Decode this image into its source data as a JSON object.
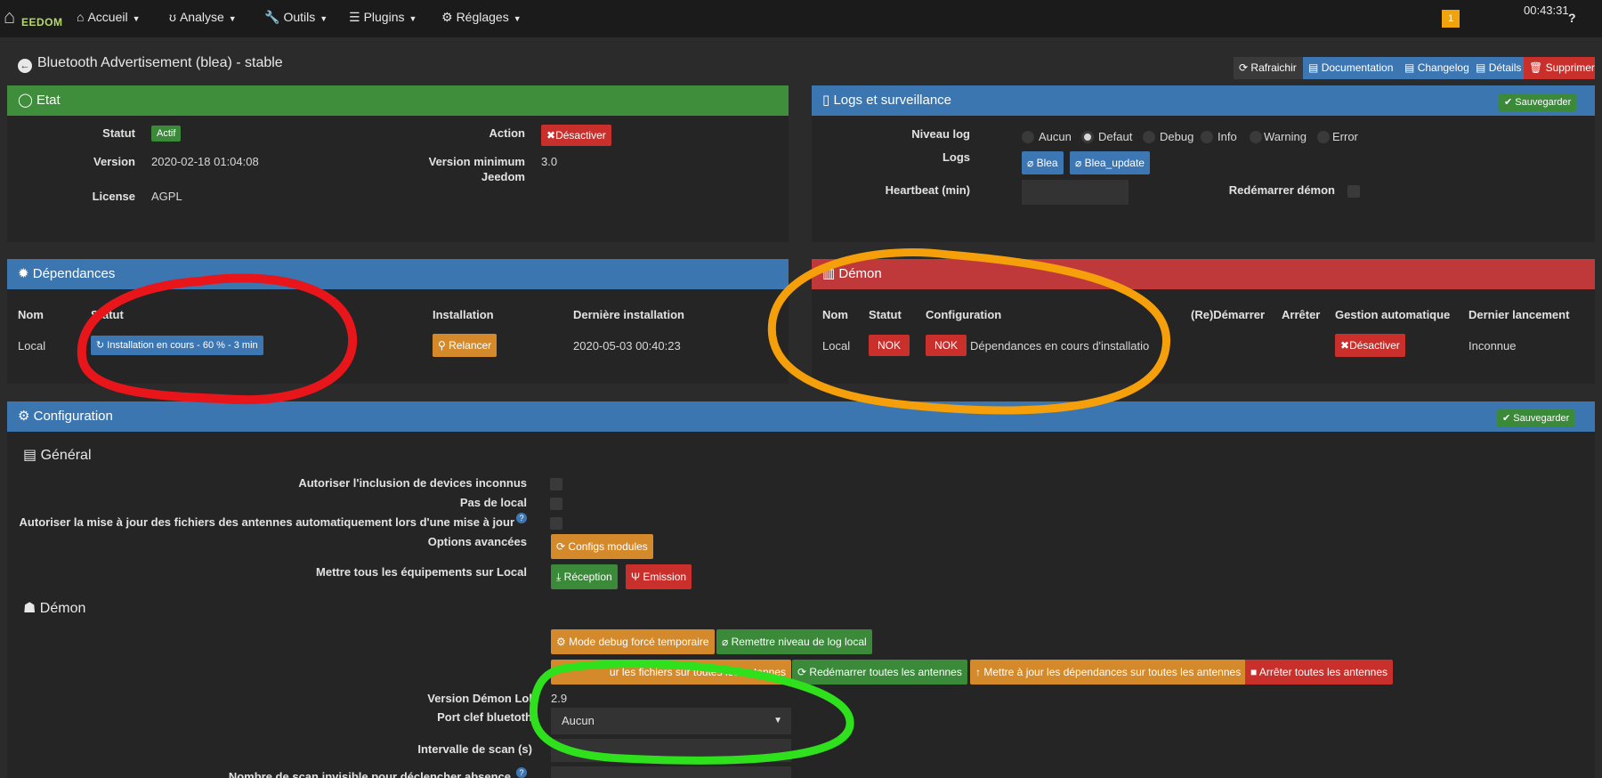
{
  "navbar": {
    "logo_text": "EEDOM",
    "items": [
      {
        "icon": "home-icon",
        "label": "Accueil"
      },
      {
        "icon": "stethoscope-icon",
        "label": "Analyse"
      },
      {
        "icon": "wrench-icon",
        "label": "Outils"
      },
      {
        "icon": "list-icon",
        "label": "Plugins"
      },
      {
        "icon": "gear-icon",
        "label": "Réglages"
      }
    ],
    "message_count": "1",
    "clock": "00:43:31",
    "help": "?"
  },
  "page": {
    "title": "Bluetooth Advertisement (blea) - stable",
    "toolbar": {
      "refresh": "Rafraichir",
      "documentation": "Documentation",
      "changelog": "Changelog",
      "details": "Détails",
      "delete": "Supprimer"
    }
  },
  "etat": {
    "title": "Etat",
    "statut_label": "Statut",
    "statut_value": "Actif",
    "action_label": "Action",
    "action_button": "Désactiver",
    "version_label": "Version",
    "version_value": "2020-02-18 01:04:08",
    "minversion_label_1": "Version minimum",
    "minversion_label_2": "Jeedom",
    "minversion_value": "3.0",
    "license_label": "License",
    "license_value": "AGPL"
  },
  "logs": {
    "title": "Logs et surveillance",
    "save": "Sauvegarder",
    "level_label": "Niveau log",
    "levels": [
      "Aucun",
      "Defaut",
      "Debug",
      "Info",
      "Warning",
      "Error"
    ],
    "selected_level": "Defaut",
    "logs_label": "Logs",
    "log_buttons": [
      "Blea",
      "Blea_update"
    ],
    "heartbeat_label": "Heartbeat (min)",
    "restart_label": "Redémarrer démon"
  },
  "dependances": {
    "title": "Dépendances",
    "headers": {
      "nom": "Nom",
      "statut": "Statut",
      "installation": "Installation",
      "derniere": "Dernière installation"
    },
    "row": {
      "nom": "Local",
      "statut": "Installation en cours - 60 % - 3 min",
      "installation": "Relancer",
      "derniere": "2020-05-03 00:40:23"
    }
  },
  "demon": {
    "title": "Démon",
    "headers": {
      "nom": "Nom",
      "statut": "Statut",
      "configuration": "Configuration",
      "redemarrer": "(Re)Démarrer",
      "arreter": "Arrêter",
      "gestion": "Gestion automatique",
      "dernier": "Dernier lancement"
    },
    "row": {
      "nom": "Local",
      "statut": "NOK",
      "config_badge": "NOK",
      "config_text": "Dépendances en cours d'installatio",
      "gestion": "Désactiver",
      "dernier": "Inconnue"
    }
  },
  "configuration": {
    "title": "Configuration",
    "save": "Sauvegarder",
    "general_title": "Général",
    "fields": {
      "inclusion": "Autoriser l'inclusion de devices inconnus",
      "pas_local": "Pas de local",
      "maj_fichiers": "Autoriser la mise à jour des fichiers des antennes automatiquement lors d'une mise à jour",
      "options": "Options avancées",
      "options_button": "Configs modules",
      "mettre_local": "Mettre tous les équipements sur Local",
      "reception": "Réception",
      "emission": "Emission"
    },
    "demon_title": "Démon",
    "demon_buttons": {
      "debug": "Mode debug forcé temporaire",
      "reset_log": "Remettre niveau de log local",
      "maj_fichiers": "ur les fichiers sur toutes les antennes",
      "redemarrer": "Redémarrer toutes les antennes",
      "maj_dep": "Mettre à jour les dépendances sur toutes les antennes",
      "arreter": "Arrêter toutes les antennes"
    },
    "version_demon_label": "Version Démon Lo",
    "version_demon_suffix": "l",
    "version_demon_value": "2.9",
    "port_label": "Port clef blueto",
    "port_suffix": "th",
    "port_value": "Aucun",
    "intervalle_label": "Intervalle de scan (s)",
    "nombre_label": "Nombre de scan invisible pour déclencher absence"
  },
  "colors": {
    "annotation_red": "#e8161b",
    "annotation_orange": "#f5a00b",
    "annotation_green": "#2fe01c"
  }
}
